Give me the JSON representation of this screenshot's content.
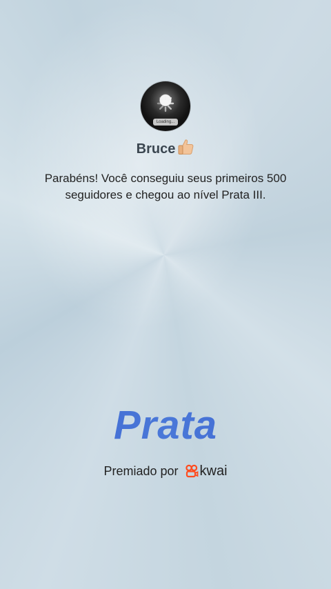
{
  "profile": {
    "avatar_loading_label": "Loading...",
    "username": "Bruce",
    "username_emoji": "thumbs-up"
  },
  "message": "Parabéns! Você conseguiu seus primeiros 500 seguidores e chegou ao nível Prata III.",
  "tier": {
    "name": "Prata",
    "color": "#3c62d0"
  },
  "sponsor": {
    "prefix": "Premiado por",
    "brand": "kwai",
    "brand_color": "#ff4c1f"
  }
}
